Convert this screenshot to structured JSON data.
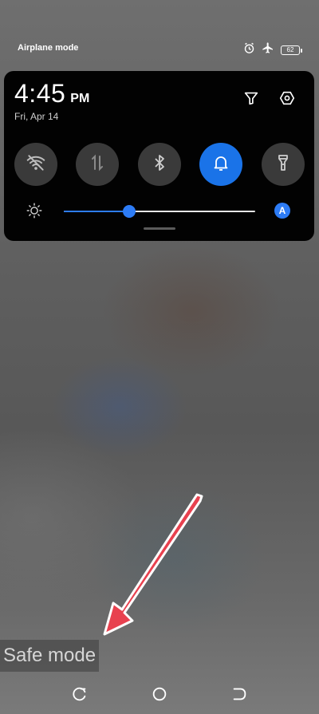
{
  "status_bar": {
    "label": "Airplane mode",
    "icons": [
      "alarm-icon",
      "airplane-icon",
      "battery-icon"
    ],
    "battery_level": "62"
  },
  "quick_panel": {
    "time": "4:45",
    "ampm": "PM",
    "date": "Fri, Apr 14",
    "top_icons": [
      "filter-icon",
      "settings-icon"
    ],
    "toggles": [
      {
        "name": "wifi",
        "icon": "wifi-off-icon",
        "active": false
      },
      {
        "name": "mobile-data",
        "icon": "mobile-data-icon",
        "active": false
      },
      {
        "name": "bluetooth",
        "icon": "bluetooth-icon",
        "active": false
      },
      {
        "name": "sound",
        "icon": "bell-icon",
        "active": true
      },
      {
        "name": "flashlight",
        "icon": "flashlight-icon",
        "active": false
      }
    ],
    "brightness": {
      "level_percent": 34,
      "auto_label": "A"
    }
  },
  "overlay": {
    "safe_mode_text": "Safe mode",
    "arrow_color": "#e8414f"
  },
  "colors": {
    "accent": "#2d7cf6",
    "panel_bg": "#020202",
    "toggle_off": "#3a3a3a"
  },
  "nav_bar": {
    "buttons": [
      "recents-icon",
      "home-icon",
      "back-icon"
    ]
  }
}
